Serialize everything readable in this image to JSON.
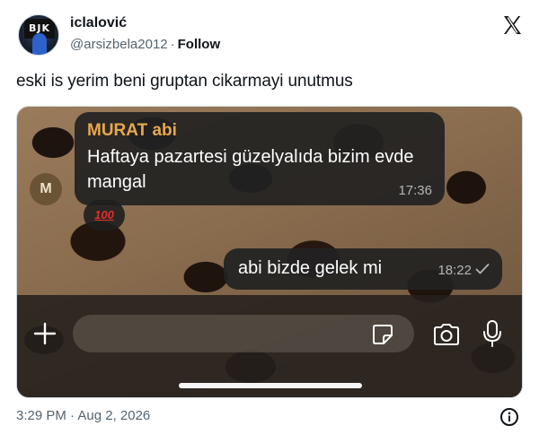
{
  "author": {
    "display_name": "iclalović",
    "handle": "@arsizbela2012",
    "separator": "·",
    "follow_label": "Follow",
    "avatar_badge_text": "BJK"
  },
  "tweet": {
    "text": "eski is yerim beni gruptan cikarmayi unutmus",
    "timestamp": "3:29 PM · Aug 2, 2026"
  },
  "chat": {
    "incoming": {
      "sender": "MURAT abi",
      "avatar_letter": "M",
      "text": "Haftaya pazartesi güzelyalıda bizim evde mangal",
      "time": "17:36",
      "reaction": "100"
    },
    "outgoing": {
      "text": "abi bizde gelek mi",
      "time": "18:22"
    },
    "input": {
      "value": "",
      "placeholder": ""
    }
  },
  "colors": {
    "sender_name": "#e8a84c",
    "bubble_bg": "#222222",
    "link_text": "#0f1419",
    "muted_text": "#536471"
  },
  "icons": {
    "brand": "x-logo-icon",
    "add": "plus-icon",
    "sticker": "sticker-icon",
    "camera": "camera-icon",
    "mic": "microphone-icon",
    "read_receipt": "checkmark-icon",
    "info": "info-icon",
    "reaction": "hundred-points-emoji-icon"
  }
}
